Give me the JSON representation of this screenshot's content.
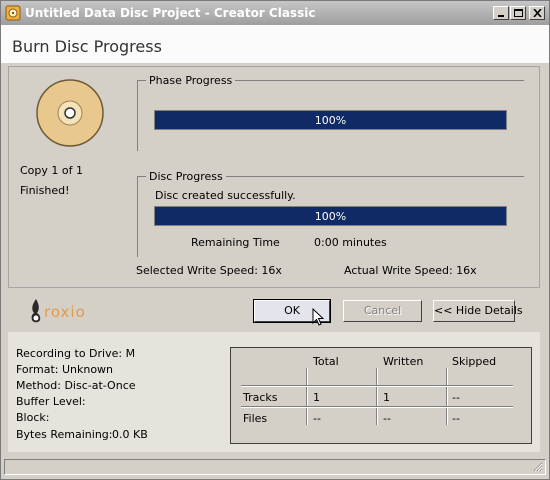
{
  "window": {
    "title": "Untitled Data Disc Project - Creator Classic",
    "app_icon": "roxio-creator-icon"
  },
  "header": {
    "title": "Burn Disc Progress"
  },
  "disc_status": {
    "copy": "Copy 1 of 1",
    "status": "Finished!"
  },
  "phase_progress": {
    "title": "Phase Progress",
    "percent": 100,
    "label": "100%"
  },
  "disc_progress": {
    "title": "Disc Progress",
    "message": "Disc created successfully.",
    "percent": 100,
    "label": "100%",
    "remaining_label": "Remaining Time",
    "remaining_value": "0:00 minutes"
  },
  "speeds": {
    "selected": "Selected Write Speed: 16x",
    "actual": "Actual Write Speed: 16x"
  },
  "logo": {
    "text": "roxio"
  },
  "buttons": {
    "ok": "OK",
    "cancel": "Cancel",
    "hide_details": "<< Hide Details"
  },
  "details": {
    "recording_drive": "Recording to Drive: M",
    "format": "Format: Unknown",
    "method": "Method: Disc-at-Once",
    "buffer_level": "Buffer Level:",
    "block": "Block:",
    "bytes_remaining_label": "Bytes Remaining:",
    "bytes_remaining_value": "0.0 KB"
  },
  "stats_table": {
    "columns": [
      "Total",
      "Written",
      "Skipped"
    ],
    "rows": [
      {
        "label": "Tracks",
        "total": "1",
        "written": "1",
        "skipped": "--"
      },
      {
        "label": "Files",
        "total": "--",
        "written": "--",
        "skipped": "--"
      }
    ]
  },
  "colors": {
    "progress_fill": "#0f2a64",
    "disc": "#e8c88c",
    "logo": "#e49a4b"
  }
}
